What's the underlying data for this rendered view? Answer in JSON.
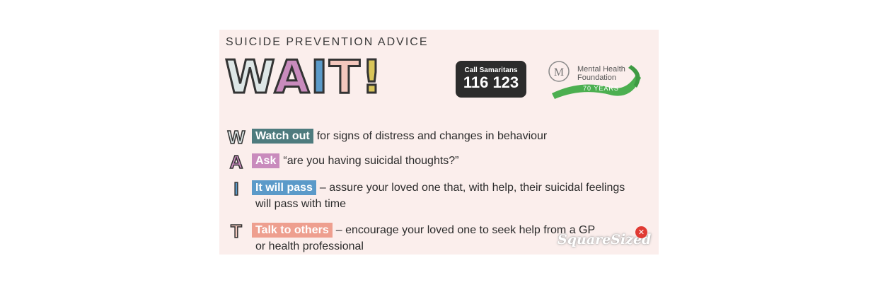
{
  "header": {
    "eyebrow": "SUICIDE PREVENTION ADVICE",
    "wait_letters": [
      "W",
      "A",
      "I",
      "T",
      "!"
    ]
  },
  "samaritans": {
    "call_label": "Call Samaritans",
    "number": "116 123"
  },
  "mhf": {
    "line1": "Mental Health",
    "line2": "Foundation",
    "years": "70 YEARS"
  },
  "steps": [
    {
      "letter": "W",
      "tag": "Watch out",
      "text": "for signs of distress and changes in behaviour",
      "text2": ""
    },
    {
      "letter": "A",
      "tag": "Ask",
      "text": "“are you having suicidal thoughts?”",
      "text2": ""
    },
    {
      "letter": "I",
      "tag": "It will pass",
      "text": "– assure your loved one that, with help, their suicidal feelings",
      "text2": "will pass with time"
    },
    {
      "letter": "T",
      "tag": "Talk to others",
      "text": "– encourage your loved one to seek help from a GP",
      "text2": "or health professional"
    }
  ],
  "watermark": "SquareSized",
  "colors": {
    "card_bg": "#fbeeec",
    "w": "#4e7b7e",
    "a": "#c98bbd",
    "i": "#5b9ac9",
    "t": "#ee9f8f",
    "exclaim": "#d9c55a",
    "ribbon": "#4caf50"
  }
}
